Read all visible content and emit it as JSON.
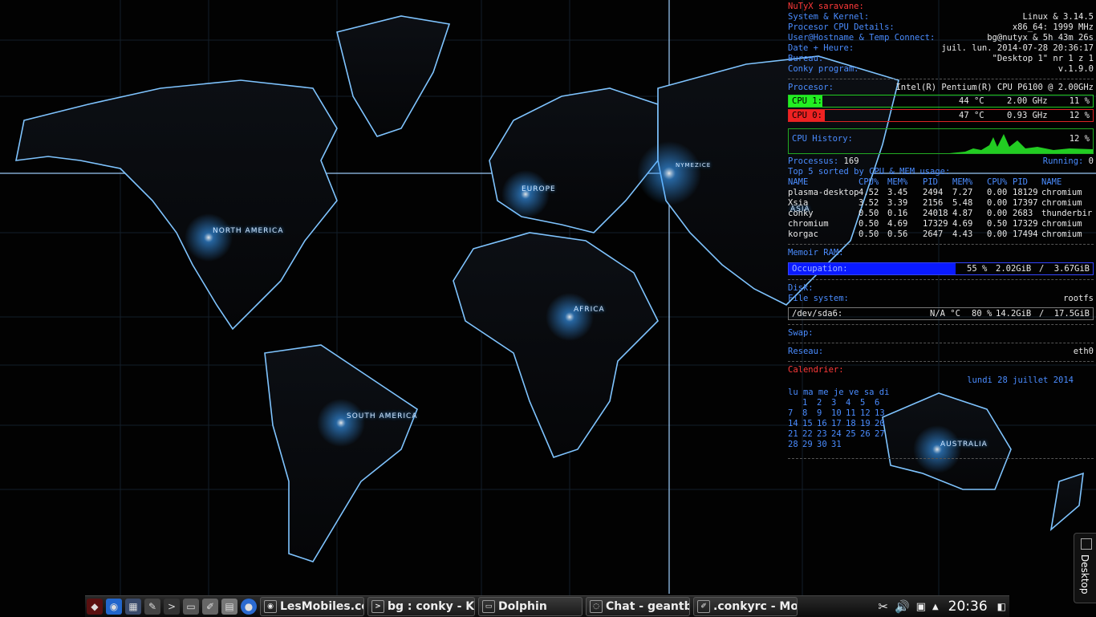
{
  "map": {
    "labels": [
      "NORTH AMERICA",
      "EUROPE",
      "ASIA",
      "AFRICA",
      "SOUTH AMERICA",
      "AUSTRALIA",
      "NYMEZICE"
    ],
    "accent": "#3aa0ff"
  },
  "conky": {
    "header": "NuTyX saravane:",
    "system_label": "System & Kernel:",
    "system_value": "Linux & 3.14.5",
    "cpu_details_label": "Procesor CPU Details:",
    "cpu_details_value": "x86_64: 1999 MHz",
    "user_label": "User@Hostname & Temp Connect:",
    "user_value": "bg@nutyx & 5h 43m 26s",
    "date_label": "Date + Heure:",
    "date_value": "juil. lun. 2014-07-28 20:36:17",
    "bureau_label": "Bureau:",
    "bureau_value": "\"Desktop 1\"  nr  1 z 1",
    "program_label": "Conky program:",
    "program_value": "v.1.9.0",
    "processor_label": "Procesor:",
    "processor_value": "Intel(R) Pentium(R) CPU      P6100  @ 2.00GHz",
    "cpu1": {
      "label": "CPU 1:",
      "temp": "44 °C",
      "freq": "2.00 GHz",
      "pct": "11 %",
      "level": 0.11,
      "color": "#22ee22"
    },
    "cpu0": {
      "label": "CPU 0:",
      "temp": "47 °C",
      "freq": "0.93 GHz",
      "pct": "12 %",
      "level": 0.12,
      "color": "#ee2222"
    },
    "history_label": "CPU History:",
    "history_pct": "12 %",
    "processus_label": "Processus:",
    "processus_value": "169",
    "running_label": "Running:",
    "running_value": "0",
    "top_label": "Top 5 sorted by CPU & MEM usage:",
    "top_headers": [
      "NAME",
      "CPU%",
      "MEM%",
      "PID",
      "MEM%",
      "CPU%",
      "PID",
      "NAME"
    ],
    "top_rows": [
      [
        "plasma-desktop",
        "4.52",
        "3.45",
        "2494",
        "7.27",
        "0.00",
        "18129",
        "chromium"
      ],
      [
        "Xsia",
        "3.52",
        "3.39",
        "2156",
        "5.48",
        "0.00",
        "17397",
        "chromium"
      ],
      [
        "conky",
        "0.50",
        "0.16",
        "24018",
        "4.87",
        "0.00",
        "2683",
        "thunderbir"
      ],
      [
        "chromium",
        "0.50",
        "4.69",
        "17329",
        "4.69",
        "0.50",
        "17329",
        "chromium"
      ],
      [
        "korgac",
        "0.50",
        "0.56",
        "2647",
        "4.43",
        "0.00",
        "17494",
        "chromium"
      ]
    ],
    "ram_label": "Memoir RAM:",
    "occupation_label": "Occupation:",
    "occupation_pct": "55 %",
    "occupation_used": "2.02GiB",
    "occupation_sep": "/",
    "occupation_total": "3.67GiB",
    "occupation_level": 0.55,
    "disk_label": "Disk:",
    "fs_label": "File system:",
    "fs_value": "rootfs",
    "dev_label": "/dev/sda6:",
    "dev_temp": "N/A °C",
    "dev_pct": "80 %",
    "dev_used": "14.2GiB",
    "dev_sep": "/",
    "dev_total": "17.5GiB",
    "swap_label": "Swap:",
    "reseau_label": "Reseau:",
    "reseau_value": "eth0",
    "calendar_label": "Calendrier:",
    "calendar_date": "lundi  28   juillet 2014",
    "calendar_head": "lu ma me je ve sa di",
    "calendar_weeks": [
      [
        "",
        "1",
        "2",
        "3",
        "4",
        "5",
        "6"
      ],
      [
        "7",
        "8",
        "9",
        "10",
        "11",
        "12",
        "13"
      ],
      [
        "14",
        "15",
        "16",
        "17",
        "18",
        "19",
        "20"
      ],
      [
        "21",
        "22",
        "23",
        "24",
        "25",
        "26",
        "27"
      ],
      [
        "28",
        "29",
        "30",
        "31",
        "",
        "",
        ""
      ]
    ],
    "label_color": "#4a8cff",
    "occupation_color": "#0a1aff"
  },
  "taskbar": {
    "tasks": [
      "LesMobiles.com",
      "bg : conky - Ko",
      "Dolphin",
      "Chat - geantbr",
      ".conkyrc - Mou"
    ],
    "clock": "20:36",
    "desktop_label": "Desktop"
  }
}
